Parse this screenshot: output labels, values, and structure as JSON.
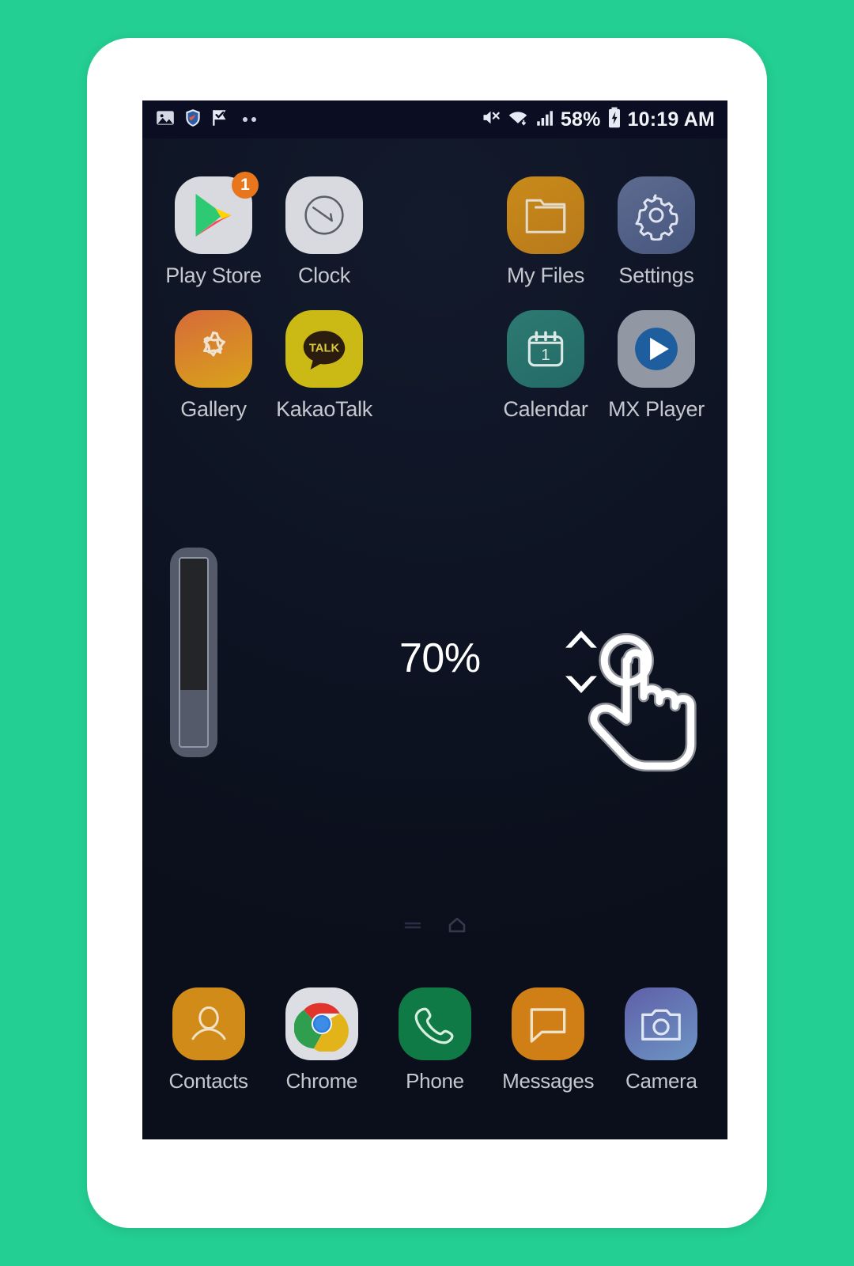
{
  "theme": {
    "page_background": "#23cf93",
    "phone_frame": "#ffffff",
    "screen_background": "#0d1322",
    "status_bar_background": "#0b0e22",
    "label_color": "#c6c8cf",
    "accent_badge": "#e8761c"
  },
  "status_bar": {
    "left_icons": [
      {
        "name": "photo-icon",
        "glyph": "image"
      },
      {
        "name": "shield-icon",
        "glyph": "shield"
      },
      {
        "name": "flag-check-icon",
        "glyph": "flag-check"
      },
      {
        "name": "more-notifications-icon",
        "glyph": "two-dots"
      }
    ],
    "right_icons": [
      {
        "name": "mute-icon",
        "glyph": "speaker-muted"
      },
      {
        "name": "wifi-icon",
        "glyph": "wifi"
      },
      {
        "name": "signal-icon",
        "glyph": "signal-bars"
      }
    ],
    "battery_percent": "58%",
    "battery_icon": "battery-charging-icon",
    "clock": "10:19 AM"
  },
  "apps": {
    "row1": [
      {
        "name": "play-store",
        "label": "Play Store",
        "badge": "1",
        "icon": "play-store-icon"
      },
      {
        "name": "clock",
        "label": "Clock",
        "badge": "",
        "icon": "clock-icon"
      },
      {
        "name": "spacer",
        "label": "",
        "badge": "",
        "icon": ""
      },
      {
        "name": "my-files",
        "label": "My Files",
        "badge": "",
        "icon": "folder-icon"
      }
    ],
    "row1_last": {
      "name": "settings",
      "label": "Settings",
      "badge": "",
      "icon": "gear-icon"
    },
    "row2": [
      {
        "name": "gallery",
        "label": "Gallery",
        "badge": "",
        "icon": "flower-icon"
      },
      {
        "name": "kakaotalk",
        "label": "KakaoTalk",
        "badge": "",
        "icon": "talk-bubble-icon",
        "bubble_text": "TALK"
      },
      {
        "name": "spacer",
        "label": "",
        "badge": "",
        "icon": ""
      },
      {
        "name": "calendar",
        "label": "Calendar",
        "badge": "",
        "icon": "calendar-icon",
        "day": "1"
      }
    ],
    "row2_last": {
      "name": "mx-player",
      "label": "MX Player",
      "badge": "",
      "icon": "play-circle-icon"
    }
  },
  "slider_widget": {
    "name": "vertical-slider",
    "value_percent": 70,
    "fill_percent_from_top": 70,
    "percent_text": "70%",
    "stepper": {
      "up": "chevron-up-icon",
      "down": "chevron-down-icon"
    },
    "cursor": "hand-tap-cursor-icon"
  },
  "page_indicator": {
    "items": [
      {
        "name": "page-dot-apps",
        "glyph": "lines"
      },
      {
        "name": "page-dot-home",
        "glyph": "home"
      }
    ]
  },
  "dock": [
    {
      "name": "contacts",
      "label": "Contacts",
      "icon": "person-icon"
    },
    {
      "name": "chrome",
      "label": "Chrome",
      "icon": "chrome-icon"
    },
    {
      "name": "phone",
      "label": "Phone",
      "icon": "phone-handset-icon"
    },
    {
      "name": "messages",
      "label": "Messages",
      "icon": "message-bubble-icon"
    },
    {
      "name": "camera",
      "label": "Camera",
      "icon": "camera-icon"
    }
  ]
}
